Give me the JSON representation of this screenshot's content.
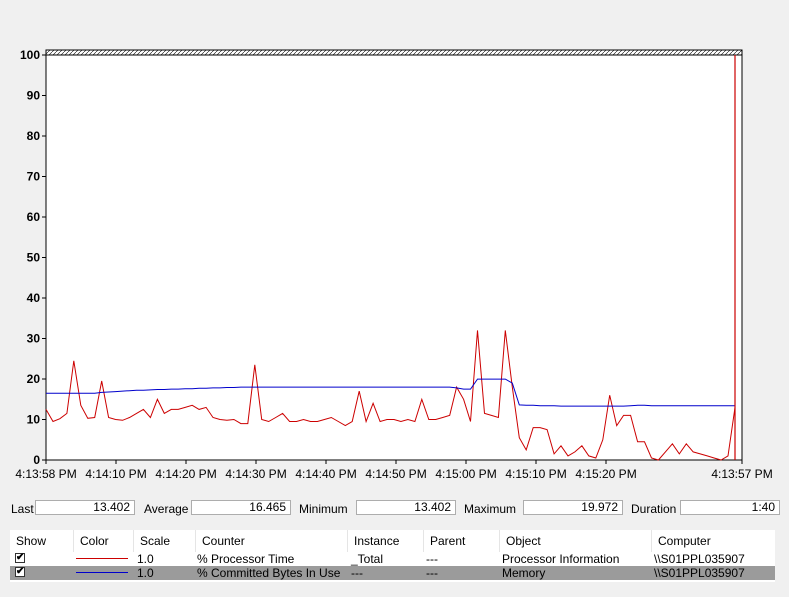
{
  "chart_data": {
    "type": "line",
    "ylim": [
      0,
      100
    ],
    "yticks": [
      "100",
      "90",
      "80",
      "70",
      "60",
      "50",
      "40",
      "30",
      "20",
      "10",
      "0"
    ],
    "xtick_labels": [
      "4:13:58 PM",
      "4:14:10 PM",
      "4:14:20 PM",
      "4:14:30 PM",
      "4:14:40 PM",
      "4:14:50 PM",
      "4:15:00 PM",
      "4:15:10 PM",
      "4:15:20 PM",
      "4:13:57 PM"
    ],
    "samples": 100,
    "series": [
      {
        "name": "% Processor Time",
        "color": "#cc0000",
        "values": [
          12.5,
          9.5,
          10.2,
          11.5,
          24.5,
          13.5,
          10.3,
          10.5,
          19.5,
          10.5,
          10.0,
          9.8,
          10.5,
          11.5,
          12.5,
          10.5,
          15.0,
          11.5,
          12.5,
          12.5,
          13.0,
          13.5,
          12.5,
          13.0,
          10.5,
          10.0,
          9.8,
          10.0,
          9.0,
          9.0,
          23.5,
          10.0,
          9.5,
          10.5,
          11.5,
          9.5,
          9.5,
          10.0,
          9.5,
          9.5,
          10.0,
          10.5,
          9.5,
          8.5,
          9.5,
          17.0,
          9.5,
          14.0,
          9.5,
          10.0,
          10.0,
          9.5,
          10.0,
          9.5,
          15.0,
          10.0,
          10.0,
          10.5,
          11.0,
          18.0,
          15.0,
          9.5,
          32.0,
          11.5,
          11.0,
          10.5,
          32.0,
          18.0,
          5.5,
          2.5,
          8.0,
          8.0,
          7.5,
          1.5,
          3.5,
          1.0,
          2.0,
          3.5,
          1.0,
          0.5,
          5.0,
          16.0,
          8.5,
          11.0,
          11.0,
          4.5,
          4.5,
          0.5,
          0.0,
          2.0,
          4.0,
          1.5,
          4.0,
          2.0,
          1.5,
          1.0,
          0.5,
          0.0,
          1.0,
          13.0
        ],
        "visible": true
      },
      {
        "name": "% Committed Bytes In Use",
        "color": "#0000cc",
        "values": [
          16.5,
          16.5,
          16.5,
          16.5,
          16.5,
          16.5,
          16.5,
          16.5,
          16.7,
          16.8,
          16.9,
          17.0,
          17.1,
          17.2,
          17.2,
          17.3,
          17.4,
          17.4,
          17.5,
          17.5,
          17.6,
          17.6,
          17.7,
          17.7,
          17.8,
          17.8,
          17.9,
          17.9,
          18.0,
          18.0,
          18.0,
          18.0,
          18.0,
          18.0,
          18.0,
          18.0,
          18.0,
          18.0,
          18.0,
          18.0,
          18.0,
          18.0,
          18.0,
          18.0,
          18.0,
          18.0,
          18.0,
          18.0,
          18.0,
          18.0,
          18.0,
          18.0,
          18.0,
          18.0,
          18.0,
          18.0,
          18.0,
          18.0,
          18.0,
          17.8,
          17.5,
          17.5,
          19.972,
          19.972,
          19.972,
          19.972,
          19.972,
          19.0,
          13.6,
          13.5,
          13.5,
          13.4,
          13.4,
          13.4,
          13.3,
          13.3,
          13.3,
          13.3,
          13.3,
          13.3,
          13.3,
          13.3,
          13.3,
          13.3,
          13.4,
          13.5,
          13.5,
          13.4,
          13.4,
          13.4,
          13.4,
          13.4,
          13.4,
          13.4,
          13.4,
          13.4,
          13.4,
          13.4,
          13.4,
          13.402
        ],
        "visible": true
      }
    ],
    "current_sample_index": 99
  },
  "stats": {
    "last_label": "Last",
    "last_value": "13.402",
    "average_label": "Average",
    "average_value": "16.465",
    "minimum_label": "Minimum",
    "minimum_value": "13.402",
    "maximum_label": "Maximum",
    "maximum_value": "19.972",
    "duration_label": "Duration",
    "duration_value": "1:40"
  },
  "table": {
    "headers": [
      "Show",
      "Color",
      "Scale",
      "Counter",
      "Instance",
      "Parent",
      "Object",
      "Computer"
    ],
    "rows": [
      {
        "show": "✔",
        "color": "#cc0000",
        "scale": "1.0",
        "counter": "% Processor Time",
        "instance": "_Total",
        "parent": "---",
        "object": "Processor Information",
        "computer": "\\\\S01PPL035907",
        "selected": false
      },
      {
        "show": "✔",
        "color": "#0000cc",
        "scale": "1.0",
        "counter": "% Committed Bytes In Use",
        "instance": "---",
        "parent": "---",
        "object": "Memory",
        "computer": "\\\\S01PPL035907",
        "selected": true
      }
    ]
  }
}
